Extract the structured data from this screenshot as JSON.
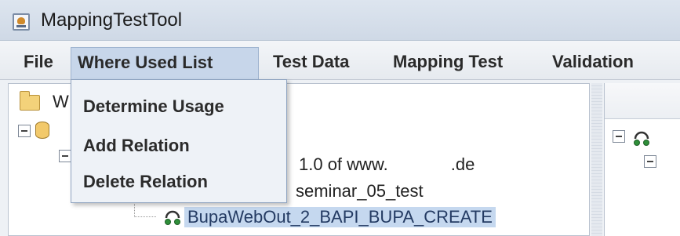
{
  "window": {
    "title": "MappingTestTool"
  },
  "menubar": {
    "items": [
      {
        "label": "File"
      },
      {
        "label": "Where Used List"
      },
      {
        "label": "Test Data"
      },
      {
        "label": "Mapping Test"
      },
      {
        "label": "Validation"
      }
    ],
    "active": "Where Used List"
  },
  "dropdown": {
    "items": [
      {
        "label": "Determine Usage"
      },
      {
        "label": "Add Relation"
      },
      {
        "label": "Delete Relation"
      }
    ]
  },
  "tree": {
    "root_label_fragment": "W",
    "node_version_prefix": "1.0 of www.",
    "node_version_suffix": ".de",
    "node_namespace": "seminar_05_test",
    "node_selected": "BupaWebOut_2_BAPI_BUPA_CREATE"
  },
  "colors": {
    "selection": "#c5d8ef",
    "menu_active": "#c7d6ea"
  }
}
